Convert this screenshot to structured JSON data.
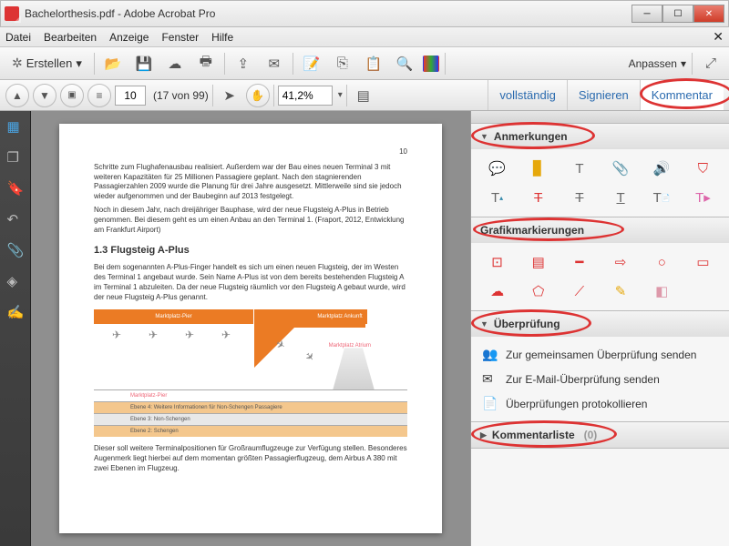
{
  "window": {
    "title": "Bachelorthesis.pdf - Adobe Acrobat Pro"
  },
  "menu": {
    "items": [
      "Datei",
      "Bearbeiten",
      "Anzeige",
      "Fenster",
      "Hilfe"
    ]
  },
  "toolbar1": {
    "erstellen": "Erstellen",
    "anpassen": "Anpassen"
  },
  "toolbar2": {
    "page_value": "10",
    "page_count": "(17 von 99)",
    "zoom": "41,2%",
    "tabs": {
      "voll": "vollständig",
      "sign": "Signieren",
      "komm": "Kommentar"
    }
  },
  "doc": {
    "pagenum": "10",
    "para1": "Schritte zum Flughafenausbau realisiert. Außerdem war der Bau eines neuen Terminal 3 mit weiteren Kapazitäten für 25 Millionen Passagiere geplant. Nach den stagnierenden Passagierzahlen 2009 wurde die Planung für drei Jahre ausgesetzt. Mittlerweile sind sie jedoch wieder aufgenommen und der Baubeginn auf 2013 festgelegt.",
    "para2": "Noch in diesem Jahr, nach dreijähriger Bauphase, wird der neue Flugsteig A-Plus in Betrieb genommen. Bei diesem geht es um einen Anbau an den Terminal 1. (Fraport, 2012, Entwicklung am Frankfurt Airport)",
    "heading": "1.3 Flugsteig A-Plus",
    "para3": "Bei dem sogenannten A-Plus-Finger handelt es sich um einen neuen Flugsteig, der im Westen des Terminal 1 angebaut wurde. Sein Name A-Plus ist von dem bereits bestehenden Flugsteig A im Terminal 1 abzuleiten. Da der neue Flugsteig räumlich vor den Flugsteig A gebaut wurde, wird der neue Flugsteig A-Plus genannt.",
    "dia": {
      "left": "Marktplatz-Pier",
      "right": "Marktplatz Ankunft",
      "atrium": "Marktplatz Atrium",
      "rows": [
        "Marktplatz-Pier",
        "Ebene 4: Weitere Informationen für Non-Schengen Passagiere",
        "Ebene 3: Non-Schengen",
        "Ebene 2: Schengen"
      ]
    },
    "para4": "Dieser soll weitere Terminalpositionen für Großraumflugzeuge zur Verfügung stellen. Besonderes Augenmerk liegt hierbei auf dem momentan größten Passagierflugzeug, dem Airbus A 380 mit zwei Ebenen im Flugzeug."
  },
  "rpanel": {
    "annot": "Anmerkungen",
    "grafik": "Grafikmarkierungen",
    "ueber": "Überprüfung",
    "ueber_items": {
      "a": "Zur gemeinsamen Überprüfung senden",
      "b": "Zur E-Mail-Überprüfung senden",
      "c": "Überprüfungen protokollieren"
    },
    "komlist": "Kommentarliste",
    "komlist_count": "(0)"
  }
}
